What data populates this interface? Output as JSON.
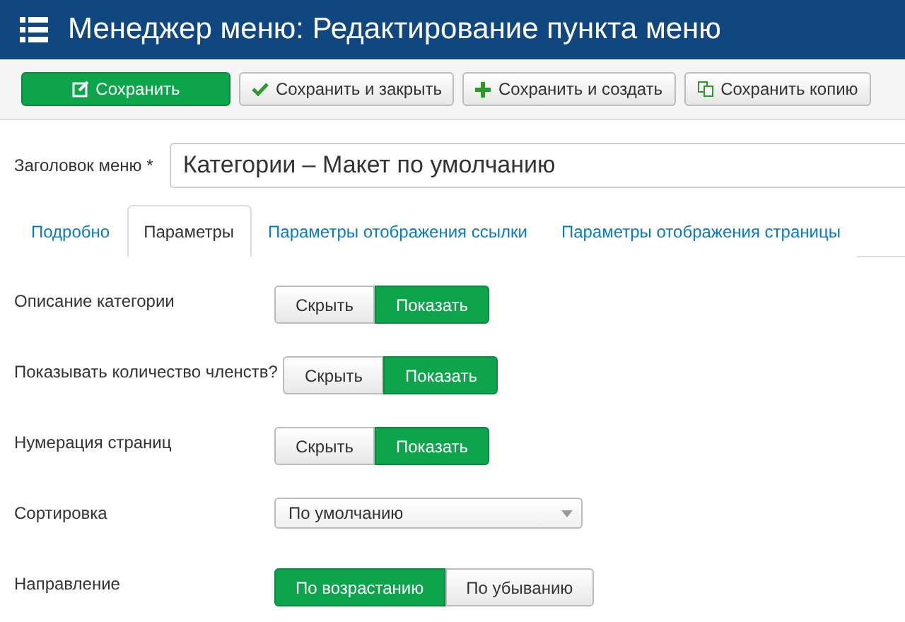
{
  "header": {
    "title": "Менеджер меню: Редактирование пункта меню"
  },
  "toolbar": [
    {
      "label": "Сохранить",
      "kind": "save"
    },
    {
      "label": "Сохранить и закрыть",
      "kind": "check"
    },
    {
      "label": "Сохранить и создать",
      "kind": "plus"
    },
    {
      "label": "Сохранить копию",
      "kind": "copy"
    }
  ],
  "title_field": {
    "label": "Заголовок меню *",
    "value": "Категории – Макет по умолчанию"
  },
  "tabs": [
    {
      "label": "Подробно",
      "selected": false
    },
    {
      "label": "Параметры",
      "selected": true
    },
    {
      "label": "Параметры отображения ссылки",
      "selected": false
    },
    {
      "label": "Параметры отображения страницы",
      "selected": false
    }
  ],
  "settings": [
    {
      "kind": "toggle",
      "label": "Описание категории",
      "options": [
        {
          "label": "Скрыть",
          "selected": false
        },
        {
          "label": "Показать",
          "selected": true
        }
      ]
    },
    {
      "kind": "toggle",
      "label": "Показывать количество членств?",
      "options": [
        {
          "label": "Скрыть",
          "selected": false
        },
        {
          "label": "Показать",
          "selected": true
        }
      ]
    },
    {
      "kind": "toggle",
      "label": "Нумерация страниц",
      "options": [
        {
          "label": "Скрыть",
          "selected": false
        },
        {
          "label": "Показать",
          "selected": true
        }
      ]
    },
    {
      "kind": "select",
      "label": "Сортировка",
      "value": "По умолчанию"
    },
    {
      "kind": "toggle",
      "label": "Направление",
      "options": [
        {
          "label": "По возрастанию",
          "selected": true
        },
        {
          "label": "По убыванию",
          "selected": false
        }
      ]
    }
  ]
}
